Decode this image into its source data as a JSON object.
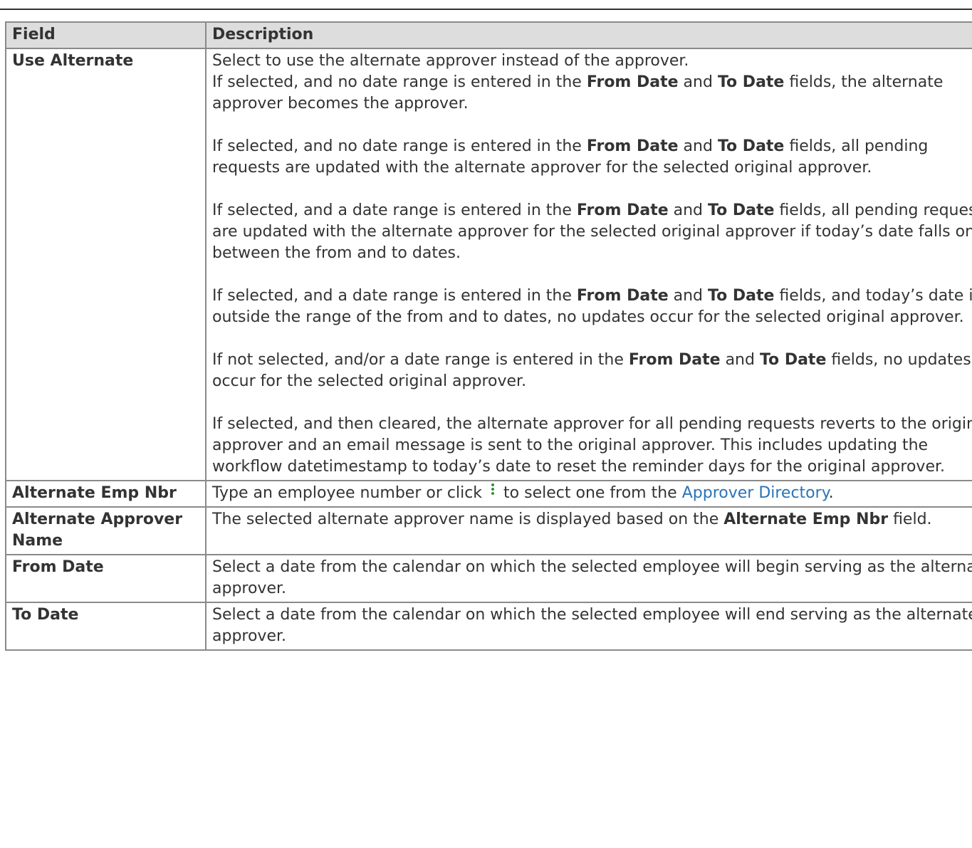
{
  "table": {
    "headers": [
      "Field",
      "Description"
    ],
    "rows": [
      {
        "field": "Use Alternate",
        "paragraphs": [
          [
            {
              "t": "Select to use the alternate approver instead of the approver.\nIf selected, and no date range is entered in the "
            },
            {
              "t": "From Date",
              "b": true
            },
            {
              "t": " and "
            },
            {
              "t": "To Date",
              "b": true
            },
            {
              "t": " fields, the alternate approver becomes the approver."
            }
          ],
          [
            {
              "t": "If selected, and no date range is entered in the "
            },
            {
              "t": "From Date",
              "b": true
            },
            {
              "t": " and "
            },
            {
              "t": "To Date",
              "b": true
            },
            {
              "t": " fields, all pending requests are updated with the alternate approver for the selected original approver."
            }
          ],
          [
            {
              "t": "If selected, and a date range is entered in the "
            },
            {
              "t": "From Date",
              "b": true
            },
            {
              "t": " and "
            },
            {
              "t": "To Date",
              "b": true
            },
            {
              "t": " fields, all pending requests are updated with the alternate approver for the selected original approver if today’s date falls on or between the from and to dates."
            }
          ],
          [
            {
              "t": "If selected, and a date range is entered in the "
            },
            {
              "t": "From Date",
              "b": true
            },
            {
              "t": " and "
            },
            {
              "t": "To Date",
              "b": true
            },
            {
              "t": " fields, and today’s date is outside the range of the from and to dates, no updates occur for the selected original approver."
            }
          ],
          [
            {
              "t": "If not selected, and/or a date range is entered in the "
            },
            {
              "t": "From Date",
              "b": true
            },
            {
              "t": " and "
            },
            {
              "t": "To Date",
              "b": true
            },
            {
              "t": " fields, no updates occur for the selected original approver."
            }
          ],
          [
            {
              "t": "If selected, and then cleared, the alternate approver for all pending requests reverts to the original approver and an email message is sent to the original approver. This includes updating the workflow datetimestamp to today’s date to reset the reminder days for the original approver."
            }
          ]
        ]
      },
      {
        "field": "Alternate Emp Nbr",
        "paragraphs": [
          [
            {
              "t": "Type an employee number or click"
            },
            {
              "icon": "vertical-ellipsis-icon"
            },
            {
              "t": "to select one from the "
            },
            {
              "t": "Approver Directory",
              "link": true
            },
            {
              "t": "."
            }
          ]
        ]
      },
      {
        "field": "Alternate Approver Name",
        "paragraphs": [
          [
            {
              "t": "The selected alternate approver name is displayed based on the "
            },
            {
              "t": "Alternate Emp Nbr",
              "b": true
            },
            {
              "t": " field."
            }
          ]
        ]
      },
      {
        "field": "From Date",
        "paragraphs": [
          [
            {
              "t": "Select a date from the calendar on which the selected employee will begin serving as the alternate approver."
            }
          ]
        ]
      },
      {
        "field": "To Date",
        "paragraphs": [
          [
            {
              "t": "Select a date from the calendar on which the selected employee will end serving as the alternate approver."
            }
          ]
        ]
      }
    ]
  }
}
